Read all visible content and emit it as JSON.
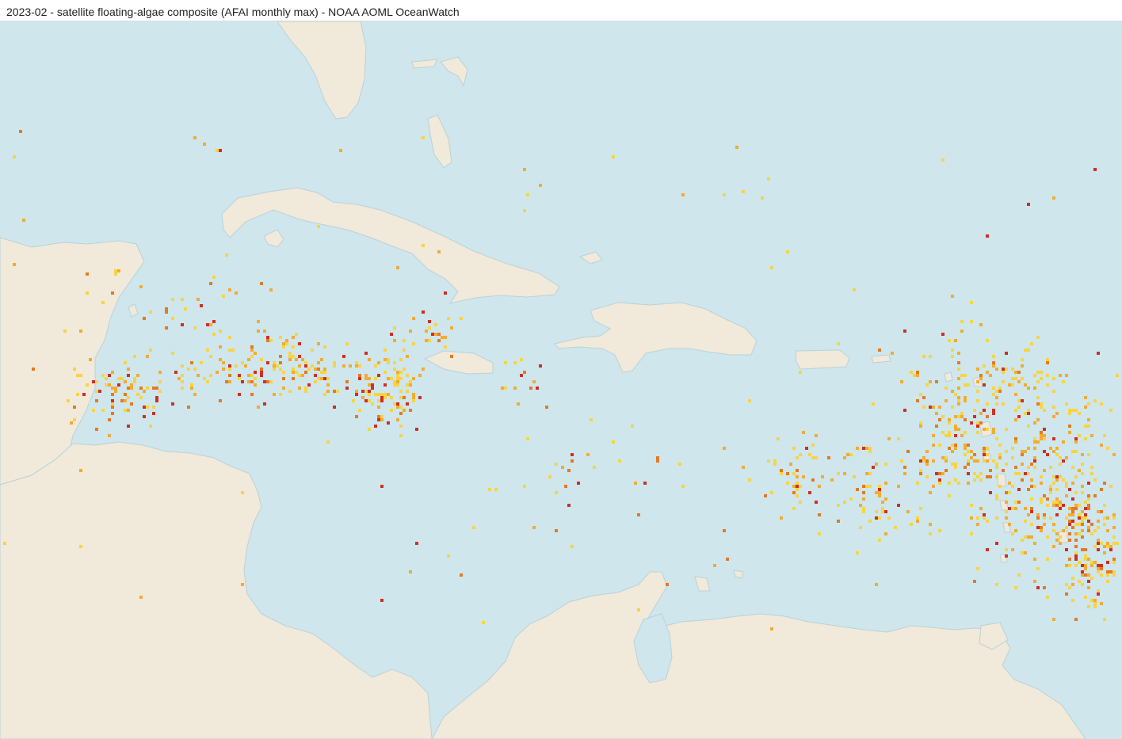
{
  "header": {
    "title": "2023-02 - satellite floating-algae composite (AFAI monthly max) - NOAA AOML OceanWatch"
  },
  "map": {
    "region": "Caribbean Sea and Gulf of Mexico",
    "layer": "satellite floating-algae composite (AFAI monthly max)",
    "period": "2023-02",
    "colors": {
      "ocean": "#cfe6ed",
      "land": "#f1e9d9",
      "coast": "#b9d2da",
      "low": "#f8d440",
      "medium": "#f3ab30",
      "high": "#e47a22",
      "max": "#cf2f23"
    }
  }
}
